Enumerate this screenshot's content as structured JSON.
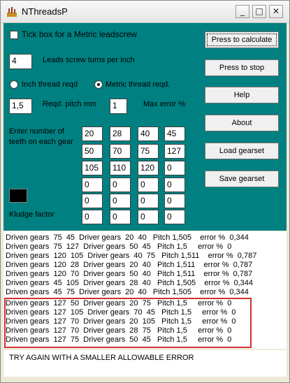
{
  "window": {
    "title": "NThreadsP",
    "minimize": "_",
    "maximize": "□",
    "close": "✕"
  },
  "form": {
    "metric_checkbox_label": "Tick box for a Metric leadscrew",
    "leadscrew_value": "4",
    "leadscrew_label": "Leads screw  turns per inch",
    "inch_radio_label": "Inch thread reqd",
    "metric_radio_label": "Metric thread reqd.",
    "pitch_value": "1,5",
    "pitch_label": "Reqd. pitch mm",
    "max_error_value": "1",
    "max_error_label": "Max error %",
    "teeth_label_1": "Enter number of",
    "teeth_label_2": "teeth on each gear",
    "kludge_label": "Kludge factor",
    "gears": [
      [
        "20",
        "28",
        "40",
        "45"
      ],
      [
        "50",
        "70",
        "75",
        "127"
      ],
      [
        "105",
        "110",
        "120",
        "0"
      ],
      [
        "0",
        "0",
        "0",
        "0"
      ],
      [
        "0",
        "0",
        "0",
        "0"
      ],
      [
        "0",
        "0",
        "0",
        "0"
      ]
    ]
  },
  "buttons": {
    "calculate": "Press to calculate",
    "stop": "Press to stop",
    "help": "Help",
    "about": "About",
    "load": "Load gearset",
    "save": "Save gearset"
  },
  "results": [
    "Driven gears  75  45  Driver gears  20  40   Pitch 1,505    error %  0,344",
    "Driven gears  75  127  Driver gears  50  45   Pitch 1,5     error %  0",
    "Driven gears  120  105  Driver gears  40  75   Pitch 1,511    error %  0,787",
    "Driven gears  120  28  Driver gears  20  40   Pitch 1,511    error %  0,787",
    "Driven gears  120  70  Driver gears  50  40   Pitch 1,511    error %  0,787",
    "Driven gears  45  105  Driver gears  28  40   Pitch 1,505    error %  0,344",
    "Driven gears  45  75  Driver gears  20  40   Pitch 1,505    error %  0,344",
    "Driven gears  127  50  Driver gears  20  75   Pitch 1,5     error %  0",
    "Driven gears  127  105  Driver gears  70  45   Pitch 1,5     error %  0",
    "Driven gears  127  70  Driver gears  20  105   Pitch 1,5     error %  0",
    "Driven gears  127  70  Driver gears  28  75   Pitch 1,5     error %  0",
    "Driven gears  127  75  Driver gears  50  45   Pitch 1,5     error %  0"
  ],
  "status_message": "TRY AGAIN WITH A SMALLER ALLOWABLE ERROR"
}
